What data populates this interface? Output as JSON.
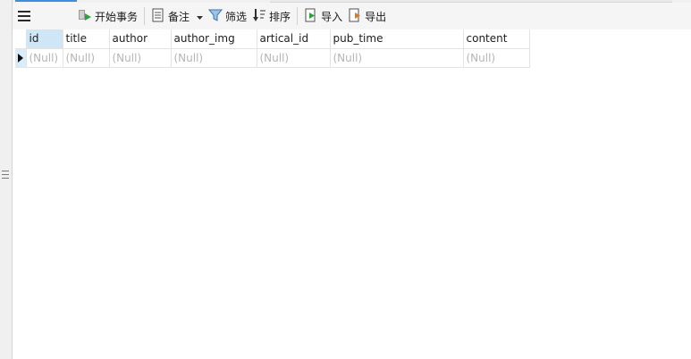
{
  "toolbar": {
    "begin_transaction": "开始事务",
    "memo": "备注",
    "filter": "筛选",
    "sort": "排序",
    "import": "导入",
    "export": "导出"
  },
  "grid": {
    "columns": [
      "id",
      "title",
      "author",
      "author_img",
      "artical_id",
      "pub_time",
      "content"
    ],
    "rows": [
      [
        "(Null)",
        "(Null)",
        "(Null)",
        "(Null)",
        "(Null)",
        "(Null)",
        "(Null)"
      ]
    ],
    "selected_header": "id"
  },
  "colors": {
    "accent": "#3c8ee0",
    "selection": "#cfe6f7",
    "null_text": "#b5b5b5"
  },
  "icons": [
    "menu-icon",
    "transaction-icon",
    "memo-icon",
    "dropdown-arrow-icon",
    "filter-icon",
    "sort-icon",
    "import-icon",
    "export-icon",
    "row-pointer-icon"
  ]
}
